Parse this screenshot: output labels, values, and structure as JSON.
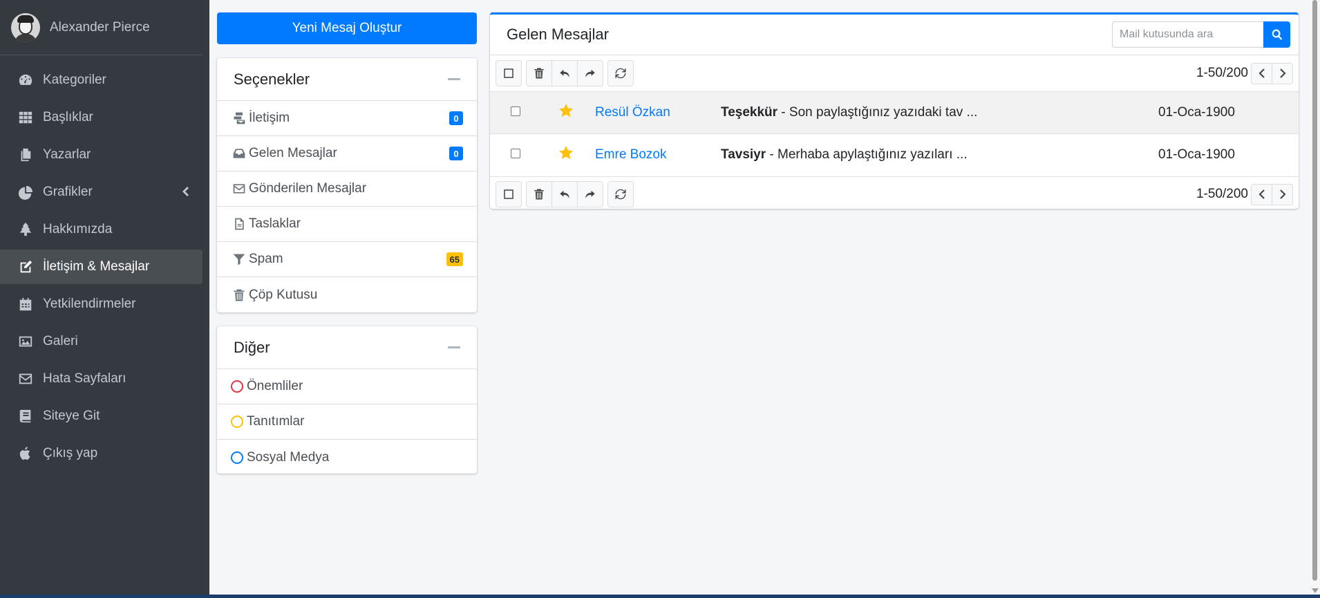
{
  "user": {
    "name": "Alexander Pierce"
  },
  "sidebar": {
    "items": [
      {
        "label": "Kategoriler",
        "icon": "tachometer-icon"
      },
      {
        "label": "Başlıklar",
        "icon": "grid-icon"
      },
      {
        "label": "Yazarlar",
        "icon": "copy-icon"
      },
      {
        "label": "Grafikler",
        "icon": "pie-chart-icon"
      },
      {
        "label": "Hakkımızda",
        "icon": "tree-icon"
      },
      {
        "label": "İletişim & Mesajlar",
        "icon": "edit-icon"
      },
      {
        "label": "Yetkilendirmeler",
        "icon": "calendar-icon"
      },
      {
        "label": "Galeri",
        "icon": "image-icon"
      },
      {
        "label": "Hata Sayfaları",
        "icon": "envelope-icon"
      },
      {
        "label": "Siteye Git",
        "icon": "book-icon"
      },
      {
        "label": "Çıkış yap",
        "icon": "apple-icon"
      }
    ],
    "active_index": 5
  },
  "compose": {
    "label": "Yeni Mesaj Oluştur"
  },
  "options_card": {
    "title": "Seçenekler",
    "items": [
      {
        "label": "İletişim",
        "icon": "mail-bulk-icon",
        "badge": "0",
        "badge_color": "#007bff"
      },
      {
        "label": "Gelen Mesajlar",
        "icon": "inbox-icon",
        "badge": "0",
        "badge_color": "#007bff"
      },
      {
        "label": "Gönderilen Mesajlar",
        "icon": "envelope-icon"
      },
      {
        "label": "Taslaklar",
        "icon": "file-icon"
      },
      {
        "label": "Spam",
        "icon": "filter-icon",
        "badge": "65",
        "badge_color": "#ffc107"
      },
      {
        "label": "Çöp Kutusu",
        "icon": "trash-icon"
      }
    ]
  },
  "other_card": {
    "title": "Diğer",
    "items": [
      {
        "label": "Önemliler",
        "color": "#dc3545"
      },
      {
        "label": "Tanıtımlar",
        "color": "#ffc107"
      },
      {
        "label": "Sosyal Medya",
        "color": "#007bff"
      }
    ]
  },
  "inbox": {
    "title": "Gelen Mesajlar",
    "search_placeholder": "Mail kutusunda ara",
    "pager_text": "1-50/200",
    "messages": [
      {
        "sender": "Resül Özkan",
        "subject": "Teşekkür",
        "preview": " - Son paylaştığınız yazıdaki tav ...",
        "date": "01-Oca-1900",
        "starred": true
      },
      {
        "sender": "Emre Bozok",
        "subject": "Tavsiyr",
        "preview": " - Merhaba apylaştığınız yazıları ...",
        "date": "01-Oca-1900",
        "starred": true
      }
    ]
  },
  "colors": {
    "primary": "#007bff",
    "sidebar_bg": "#343a40",
    "warning": "#ffc107",
    "danger": "#dc3545"
  }
}
